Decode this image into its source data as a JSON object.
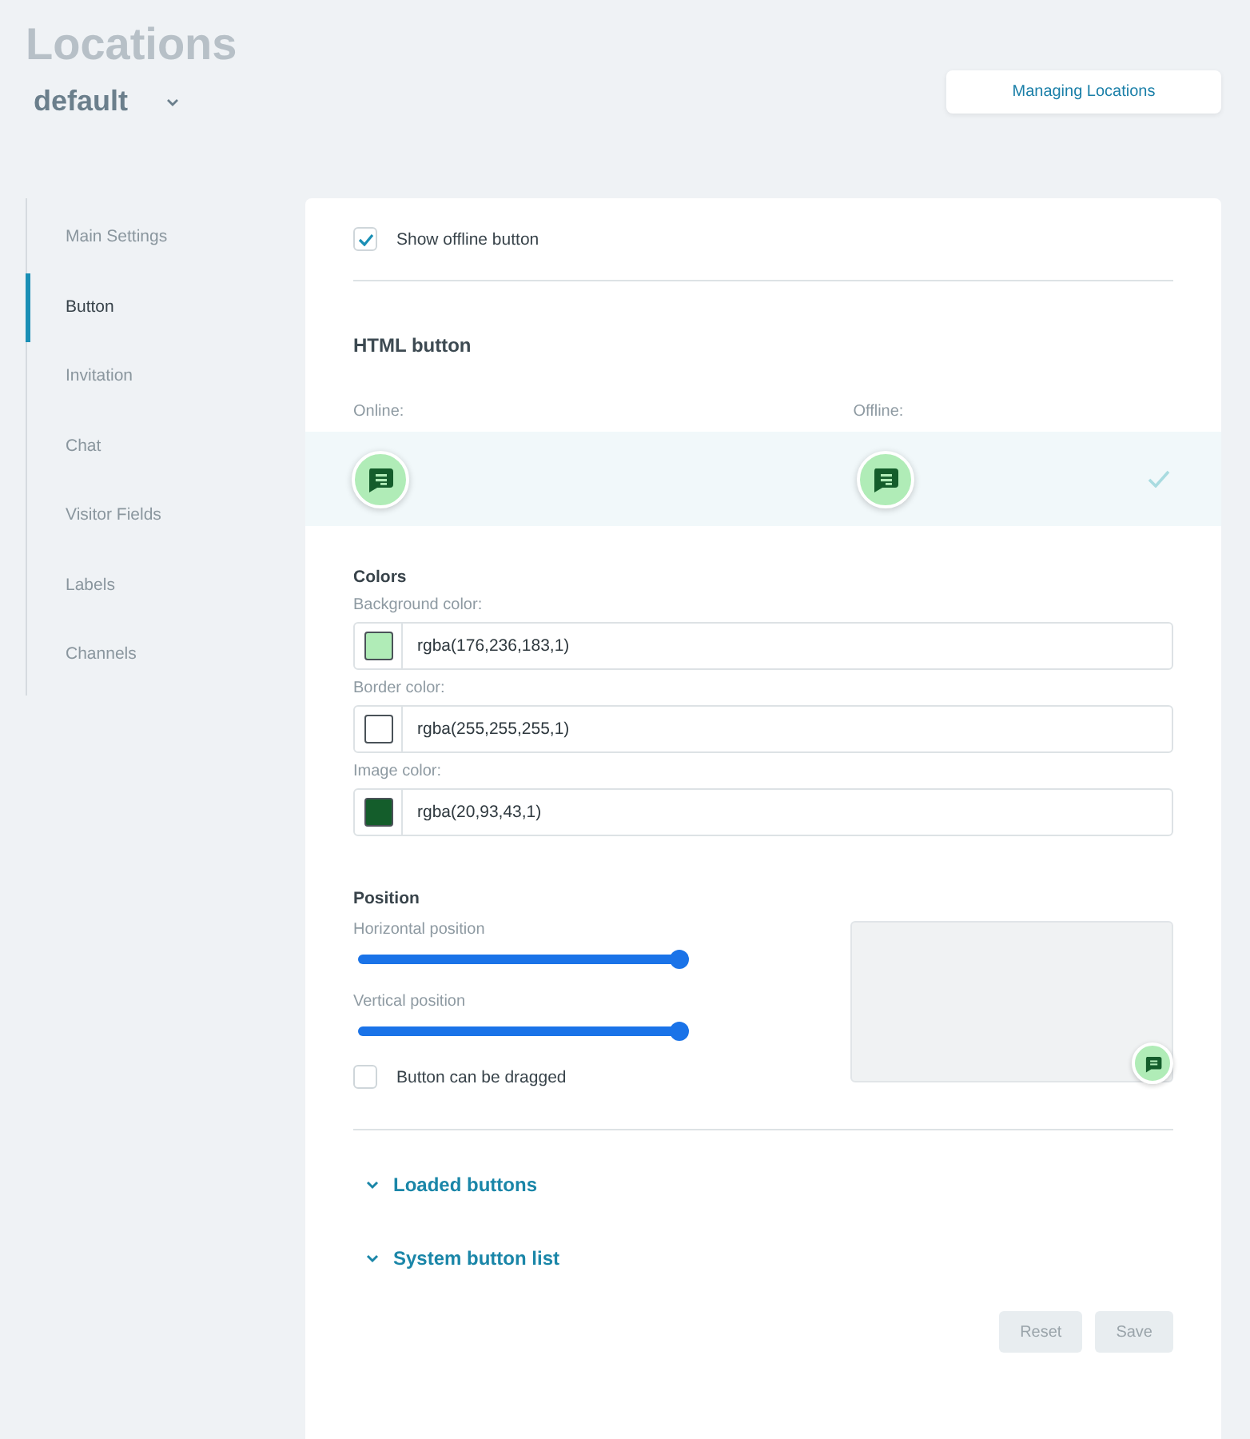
{
  "page": {
    "title": "Locations",
    "location": "default",
    "manage_button": "Managing Locations"
  },
  "sidebar": {
    "items": [
      {
        "label": "Main Settings",
        "selected": false
      },
      {
        "label": "Button",
        "selected": true
      },
      {
        "label": "Invitation",
        "selected": false
      },
      {
        "label": "Chat",
        "selected": false
      },
      {
        "label": "Visitor Fields",
        "selected": false
      },
      {
        "label": "Labels",
        "selected": false
      },
      {
        "label": "Channels",
        "selected": false
      }
    ]
  },
  "show_offline": {
    "label": "Show offline button",
    "checked": true
  },
  "html_button": {
    "title": "HTML button",
    "online_label": "Online:",
    "offline_label": "Offline:",
    "selected": true
  },
  "colors": {
    "title": "Colors",
    "fields": [
      {
        "label": "Background color:",
        "value": "rgba(176,236,183,1)",
        "color": "#b0ecb7"
      },
      {
        "label": "Border color:",
        "value": "rgba(255,255,255,1)",
        "color": "#ffffff"
      },
      {
        "label": "Image color:",
        "value": "rgba(20,93,43,1)",
        "color": "#145d2b"
      }
    ]
  },
  "position": {
    "title": "Position",
    "sliders": [
      {
        "label": "Horizontal position",
        "level": 1
      },
      {
        "label": "Vertical position",
        "level": 1
      }
    ],
    "draggable": {
      "label": "Button can be dragged",
      "checked": false
    }
  },
  "sections": [
    {
      "label": "Loaded buttons",
      "expanded": false
    },
    {
      "label": "System button list",
      "expanded": false
    }
  ],
  "actions": [
    {
      "label": "Reset",
      "disabled": true
    },
    {
      "label": "Save",
      "disabled": true
    }
  ]
}
